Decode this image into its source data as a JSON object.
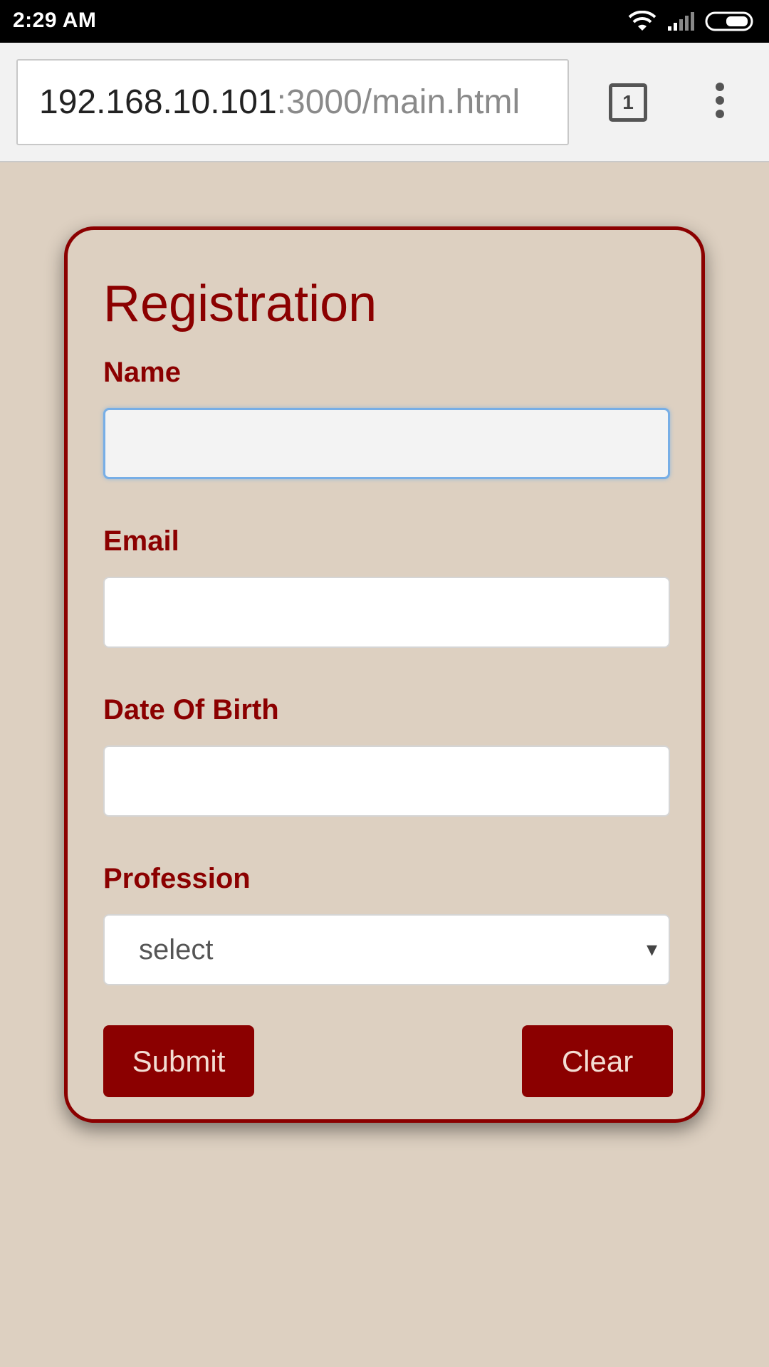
{
  "status_bar": {
    "time": "2:29 AM",
    "icons": [
      "wifi-icon",
      "signal-icon",
      "battery-icon"
    ]
  },
  "browser": {
    "url_host": "192.168.10.101",
    "url_path": ":3000/main.html",
    "tab_count": "1",
    "menu_icon": "more-vert-icon"
  },
  "form": {
    "title": "Registration",
    "name_label": "Name",
    "name_value": "",
    "email_label": "Email",
    "email_value": "",
    "dob_label": "Date Of Birth",
    "dob_value": "",
    "profession_label": "Profession",
    "profession_selected": "select",
    "profession_arrow": "▾",
    "submit_label": "Submit",
    "clear_label": "Clear"
  },
  "colors": {
    "page_background": "#ddd0c1",
    "accent": "#8b0000",
    "focus_border": "#77aee6"
  }
}
